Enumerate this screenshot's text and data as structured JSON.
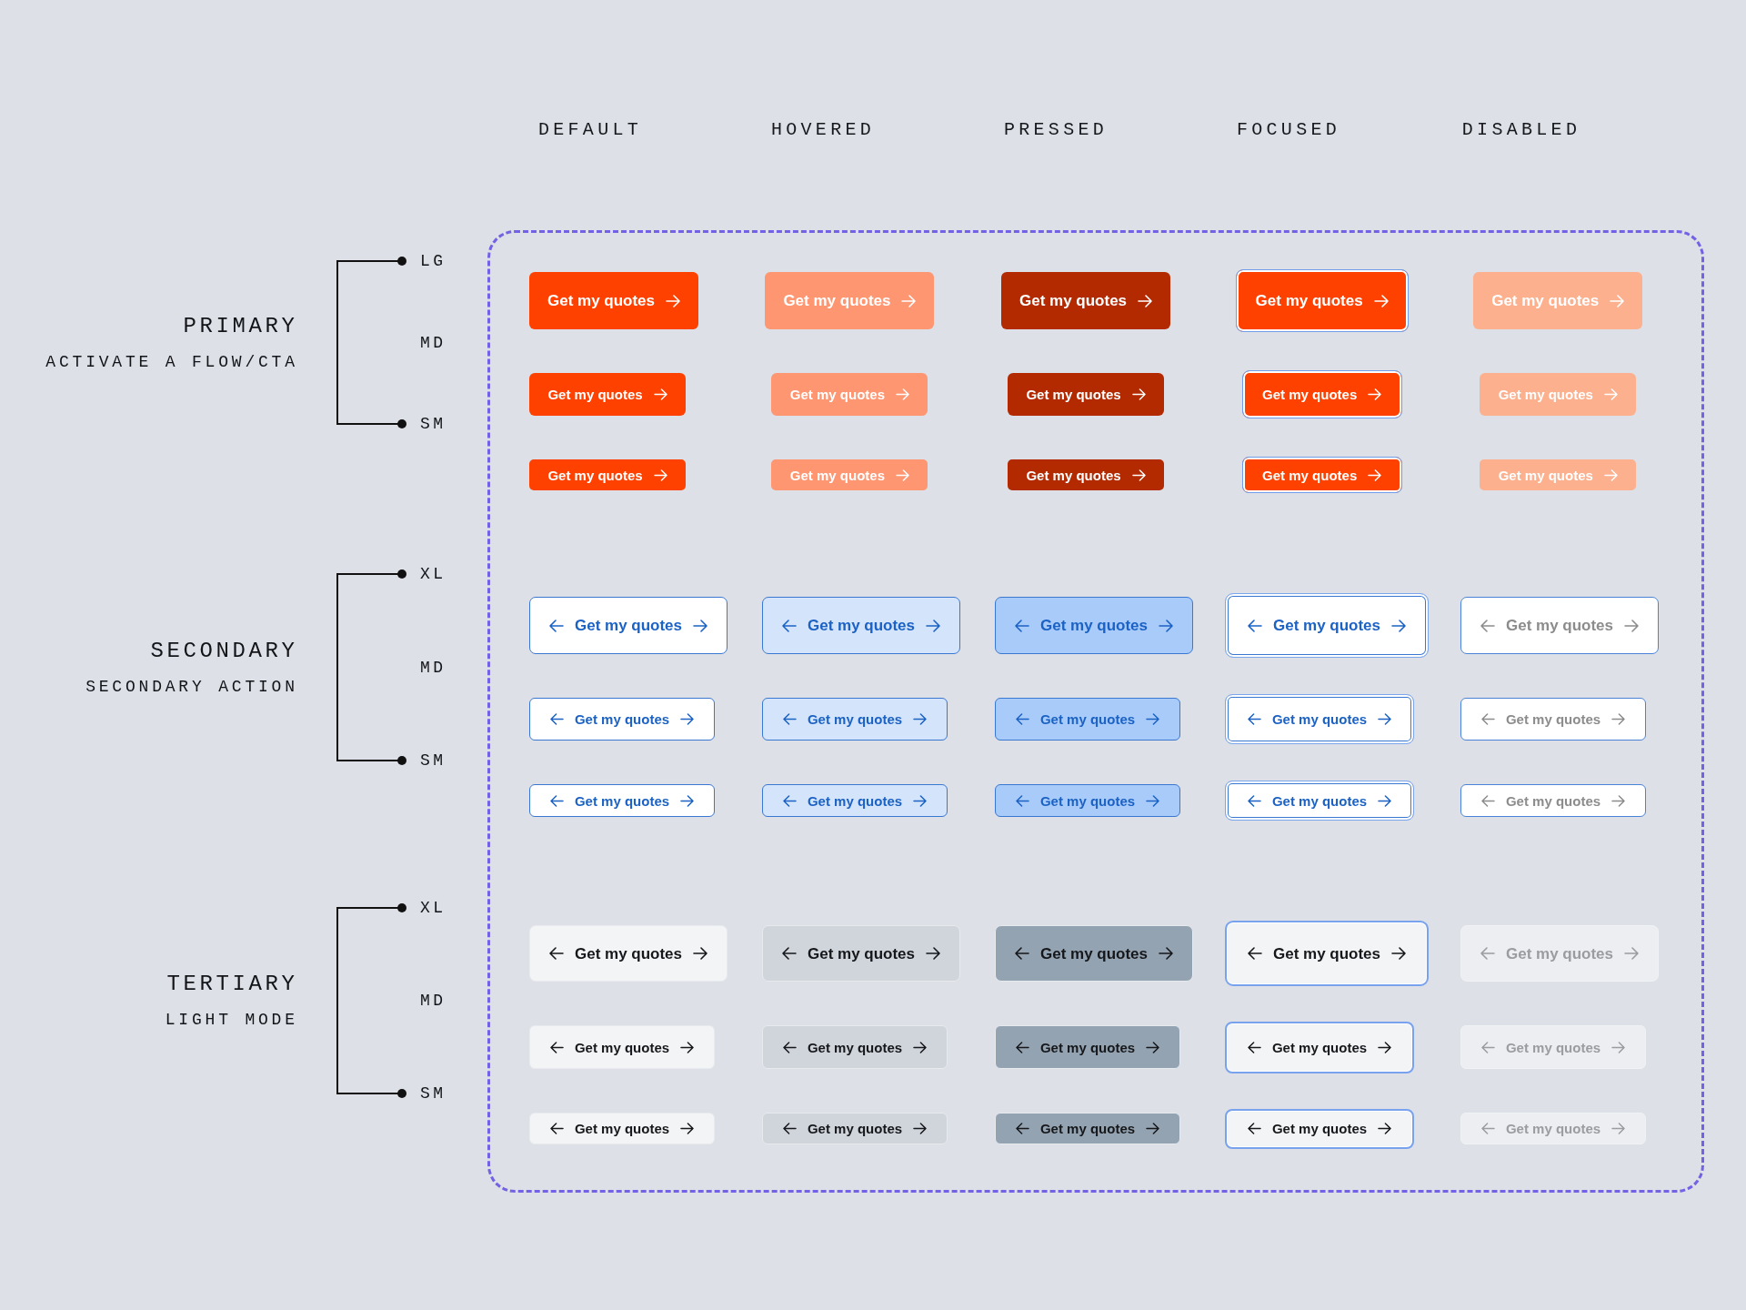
{
  "column_headers": [
    "DEFAULT",
    "HOVERED",
    "PRESSED",
    "FOCUSED",
    "DISABLED"
  ],
  "groups": [
    {
      "kind": "primary",
      "title": "PRIMARY",
      "subtitle": "ACTIVATE A FLOW/CTA",
      "size_labels": [
        "LG",
        "MD",
        "SM"
      ],
      "rows": [
        {
          "buttons": [
            {
              "label": "Get my quotes",
              "hovered": false,
              "pressed": false,
              "focused": false,
              "disabled": false
            },
            {
              "label": "Get my quotes",
              "hovered": true,
              "pressed": false,
              "focused": false,
              "disabled": false
            },
            {
              "label": "Get my quotes",
              "hovered": false,
              "pressed": true,
              "focused": false,
              "disabled": false
            },
            {
              "label": "Get my quotes",
              "hovered": false,
              "pressed": false,
              "focused": true,
              "disabled": false
            },
            {
              "label": "Get my quotes",
              "hovered": false,
              "pressed": false,
              "focused": false,
              "disabled": true
            }
          ]
        },
        {
          "buttons": [
            {
              "label": "Get my quotes",
              "hovered": false,
              "pressed": false,
              "focused": false,
              "disabled": false
            },
            {
              "label": "Get my quotes",
              "hovered": true,
              "pressed": false,
              "focused": false,
              "disabled": false
            },
            {
              "label": "Get my quotes",
              "hovered": false,
              "pressed": true,
              "focused": false,
              "disabled": false
            },
            {
              "label": "Get my quotes",
              "hovered": false,
              "pressed": false,
              "focused": true,
              "disabled": false
            },
            {
              "label": "Get my quotes",
              "hovered": false,
              "pressed": false,
              "focused": false,
              "disabled": true
            }
          ]
        },
        {
          "buttons": [
            {
              "label": "Get my quotes",
              "hovered": false,
              "pressed": false,
              "focused": false,
              "disabled": false
            },
            {
              "label": "Get my quotes",
              "hovered": true,
              "pressed": false,
              "focused": false,
              "disabled": false
            },
            {
              "label": "Get my quotes",
              "hovered": false,
              "pressed": true,
              "focused": false,
              "disabled": false
            },
            {
              "label": "Get my quotes",
              "hovered": false,
              "pressed": false,
              "focused": true,
              "disabled": false
            },
            {
              "label": "Get my quotes",
              "hovered": false,
              "pressed": false,
              "focused": false,
              "disabled": true
            }
          ]
        }
      ]
    },
    {
      "kind": "secondary",
      "title": "SECONDARY",
      "subtitle": "SECONDARY ACTION",
      "size_labels": [
        "XL",
        "MD",
        "SM"
      ],
      "rows": [
        {
          "buttons": [
            {
              "label": "Get my quotes",
              "hovered": false,
              "pressed": false,
              "focused": false,
              "disabled": false
            },
            {
              "label": "Get my quotes",
              "hovered": true,
              "pressed": false,
              "focused": false,
              "disabled": false
            },
            {
              "label": "Get my quotes",
              "hovered": false,
              "pressed": true,
              "focused": false,
              "disabled": false
            },
            {
              "label": "Get my quotes",
              "hovered": false,
              "pressed": false,
              "focused": true,
              "disabled": false
            },
            {
              "label": "Get my quotes",
              "hovered": false,
              "pressed": false,
              "focused": false,
              "disabled": true
            }
          ]
        },
        {
          "buttons": [
            {
              "label": "Get my quotes",
              "hovered": false,
              "pressed": false,
              "focused": false,
              "disabled": false
            },
            {
              "label": "Get my quotes",
              "hovered": true,
              "pressed": false,
              "focused": false,
              "disabled": false
            },
            {
              "label": "Get my quotes",
              "hovered": false,
              "pressed": true,
              "focused": false,
              "disabled": false
            },
            {
              "label": "Get my quotes",
              "hovered": false,
              "pressed": false,
              "focused": true,
              "disabled": false
            },
            {
              "label": "Get my quotes",
              "hovered": false,
              "pressed": false,
              "focused": false,
              "disabled": true
            }
          ]
        },
        {
          "buttons": [
            {
              "label": "Get my quotes",
              "hovered": false,
              "pressed": false,
              "focused": false,
              "disabled": false
            },
            {
              "label": "Get my quotes",
              "hovered": true,
              "pressed": false,
              "focused": false,
              "disabled": false
            },
            {
              "label": "Get my quotes",
              "hovered": false,
              "pressed": true,
              "focused": false,
              "disabled": false
            },
            {
              "label": "Get my quotes",
              "hovered": false,
              "pressed": false,
              "focused": true,
              "disabled": false
            },
            {
              "label": "Get my quotes",
              "hovered": false,
              "pressed": false,
              "focused": false,
              "disabled": true
            }
          ]
        }
      ]
    },
    {
      "kind": "tertiary",
      "title": "TERTIARY",
      "subtitle": "LIGHT MODE",
      "size_labels": [
        "XL",
        "MD",
        "SM"
      ],
      "rows": [
        {
          "buttons": [
            {
              "label": "Get my quotes",
              "hovered": false,
              "pressed": false,
              "focused": false,
              "disabled": false
            },
            {
              "label": "Get my quotes",
              "hovered": true,
              "pressed": false,
              "focused": false,
              "disabled": false
            },
            {
              "label": "Get my quotes",
              "hovered": false,
              "pressed": true,
              "focused": false,
              "disabled": false
            },
            {
              "label": "Get my quotes",
              "hovered": false,
              "pressed": false,
              "focused": true,
              "disabled": false
            },
            {
              "label": "Get my quotes",
              "hovered": false,
              "pressed": false,
              "focused": false,
              "disabled": true
            }
          ]
        },
        {
          "buttons": [
            {
              "label": "Get my quotes",
              "hovered": false,
              "pressed": false,
              "focused": false,
              "disabled": false
            },
            {
              "label": "Get my quotes",
              "hovered": true,
              "pressed": false,
              "focused": false,
              "disabled": false
            },
            {
              "label": "Get my quotes",
              "hovered": false,
              "pressed": true,
              "focused": false,
              "disabled": false
            },
            {
              "label": "Get my quotes",
              "hovered": false,
              "pressed": false,
              "focused": true,
              "disabled": false
            },
            {
              "label": "Get my quotes",
              "hovered": false,
              "pressed": false,
              "focused": false,
              "disabled": true
            }
          ]
        },
        {
          "buttons": [
            {
              "label": "Get my quotes",
              "hovered": false,
              "pressed": false,
              "focused": false,
              "disabled": false
            },
            {
              "label": "Get my quotes",
              "hovered": true,
              "pressed": false,
              "focused": false,
              "disabled": false
            },
            {
              "label": "Get my quotes",
              "hovered": false,
              "pressed": true,
              "focused": false,
              "disabled": false
            },
            {
              "label": "Get my quotes",
              "hovered": false,
              "pressed": false,
              "focused": true,
              "disabled": false
            },
            {
              "label": "Get my quotes",
              "hovered": false,
              "pressed": false,
              "focused": false,
              "disabled": true
            }
          ]
        }
      ]
    }
  ]
}
